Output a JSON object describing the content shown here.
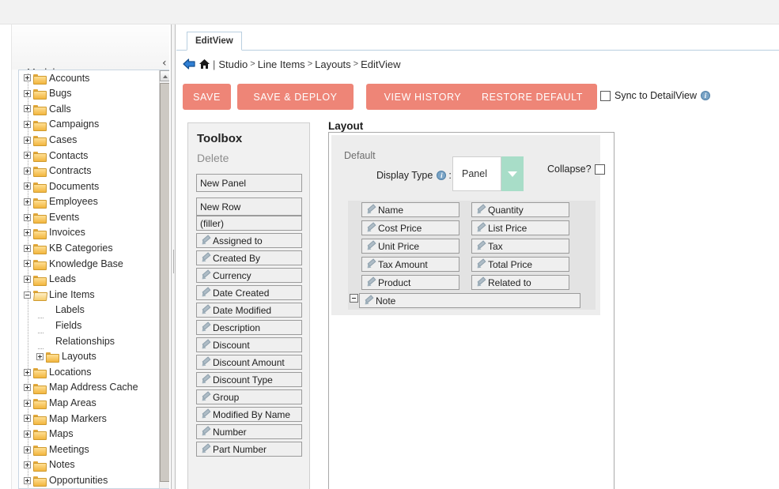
{
  "sidebar": {
    "title": "Modules",
    "collapse_icon": "‹",
    "items": [
      {
        "label": "Accounts",
        "level": 1,
        "toggle": "plus",
        "icon": "folder-icon"
      },
      {
        "label": "Bugs",
        "level": 1,
        "toggle": "plus",
        "icon": "folder-icon"
      },
      {
        "label": "Calls",
        "level": 1,
        "toggle": "plus",
        "icon": "folder-icon"
      },
      {
        "label": "Campaigns",
        "level": 1,
        "toggle": "plus",
        "icon": "folder-icon"
      },
      {
        "label": "Cases",
        "level": 1,
        "toggle": "plus",
        "icon": "folder-icon"
      },
      {
        "label": "Contacts",
        "level": 1,
        "toggle": "plus",
        "icon": "folder-icon"
      },
      {
        "label": "Contracts",
        "level": 1,
        "toggle": "plus",
        "icon": "folder-icon"
      },
      {
        "label": "Documents",
        "level": 1,
        "toggle": "plus",
        "icon": "folder-icon"
      },
      {
        "label": "Employees",
        "level": 1,
        "toggle": "plus",
        "icon": "folder-icon"
      },
      {
        "label": "Events",
        "level": 1,
        "toggle": "plus",
        "icon": "folder-icon"
      },
      {
        "label": "Invoices",
        "level": 1,
        "toggle": "plus",
        "icon": "folder-icon"
      },
      {
        "label": "KB Categories",
        "level": 1,
        "toggle": "plus",
        "icon": "folder-icon"
      },
      {
        "label": "Knowledge Base",
        "level": 1,
        "toggle": "plus",
        "icon": "folder-icon"
      },
      {
        "label": "Leads",
        "level": 1,
        "toggle": "plus",
        "icon": "folder-icon"
      },
      {
        "label": "Line Items",
        "level": 1,
        "toggle": "minus",
        "icon": "folder-open-icon"
      },
      {
        "label": "Labels",
        "level": 2,
        "toggle": "none",
        "icon": "none"
      },
      {
        "label": "Fields",
        "level": 2,
        "toggle": "none",
        "icon": "none"
      },
      {
        "label": "Relationships",
        "level": 2,
        "toggle": "none",
        "icon": "none"
      },
      {
        "label": "Layouts",
        "level": 2,
        "toggle": "plus",
        "icon": "folder-icon"
      },
      {
        "label": "Locations",
        "level": 1,
        "toggle": "plus",
        "icon": "folder-icon"
      },
      {
        "label": "Map Address Cache",
        "level": 1,
        "toggle": "plus",
        "icon": "folder-icon"
      },
      {
        "label": "Map Areas",
        "level": 1,
        "toggle": "plus",
        "icon": "folder-icon"
      },
      {
        "label": "Map Markers",
        "level": 1,
        "toggle": "plus",
        "icon": "folder-icon"
      },
      {
        "label": "Maps",
        "level": 1,
        "toggle": "plus",
        "icon": "folder-icon"
      },
      {
        "label": "Meetings",
        "level": 1,
        "toggle": "plus",
        "icon": "folder-icon"
      },
      {
        "label": "Notes",
        "level": 1,
        "toggle": "plus",
        "icon": "folder-icon"
      },
      {
        "label": "Opportunities",
        "level": 1,
        "toggle": "plus",
        "icon": "folder-icon"
      }
    ]
  },
  "tab": {
    "label": "EditView"
  },
  "breadcrumb": {
    "back_icon": "back-arrow-icon",
    "home_icon": "home-icon",
    "separator": "|",
    "chevron": ">",
    "crumbs": [
      "Studio",
      "Line Items",
      "Layouts",
      "EditView"
    ]
  },
  "toolbar": {
    "save_label": "SAVE",
    "save_deploy_label": "SAVE & DEPLOY",
    "view_history_label": "VIEW HISTORY",
    "restore_default_label": "RESTORE DEFAULT",
    "sync_label": "Sync to DetailView",
    "sync_checked": false,
    "info_icon": "i"
  },
  "toolbox": {
    "title": "Toolbox",
    "delete_label": "Delete",
    "items": [
      {
        "label": "New Panel",
        "icon": "none",
        "tall": true
      },
      {
        "label": "New Row",
        "icon": "none",
        "tall": true
      },
      {
        "label": "(filler)",
        "icon": "none",
        "tall": false
      },
      {
        "label": "Assigned to",
        "icon": "pencil-icon",
        "tall": false
      },
      {
        "label": "Created By",
        "icon": "pencil-icon",
        "tall": false
      },
      {
        "label": "Currency",
        "icon": "pencil-icon",
        "tall": false
      },
      {
        "label": "Date Created",
        "icon": "pencil-icon",
        "tall": false
      },
      {
        "label": "Date Modified",
        "icon": "pencil-icon",
        "tall": false
      },
      {
        "label": "Description",
        "icon": "pencil-icon",
        "tall": false
      },
      {
        "label": "Discount",
        "icon": "pencil-icon",
        "tall": false
      },
      {
        "label": "Discount Amount",
        "icon": "pencil-icon",
        "tall": false
      },
      {
        "label": "Discount Type",
        "icon": "pencil-icon",
        "tall": false
      },
      {
        "label": "Group",
        "icon": "pencil-icon",
        "tall": false
      },
      {
        "label": "Modified By Name",
        "icon": "pencil-icon",
        "tall": false
      },
      {
        "label": "Number",
        "icon": "pencil-icon",
        "tall": false
      },
      {
        "label": "Part Number",
        "icon": "pencil-icon",
        "tall": false
      }
    ]
  },
  "layout": {
    "title": "Layout",
    "panel_name": "Default",
    "display_type_label": "Display Type",
    "display_type_suffix": ":",
    "display_type_value": "Panel",
    "collapse_label": "Collapse?",
    "collapse_checked": false,
    "info_icon": "i",
    "rows": [
      {
        "type": "pair",
        "left": "Name",
        "right": "Quantity"
      },
      {
        "type": "pair",
        "left": "Cost Price",
        "right": "List Price"
      },
      {
        "type": "pair",
        "left": "Unit Price",
        "right": "Tax"
      },
      {
        "type": "pair",
        "left": "Tax Amount",
        "right": "Total Price"
      },
      {
        "type": "pair",
        "left": "Product",
        "right": "Related to"
      },
      {
        "type": "full",
        "left": "Note",
        "right": "",
        "collapsible": true
      }
    ]
  },
  "colors": {
    "button_salmon": "#ee8577",
    "dropdown_mint": "#a8ddc8",
    "panel_grey": "#ededed",
    "row_grey": "#e3e3e3",
    "tab_border_blue": "#b9cfe0"
  }
}
